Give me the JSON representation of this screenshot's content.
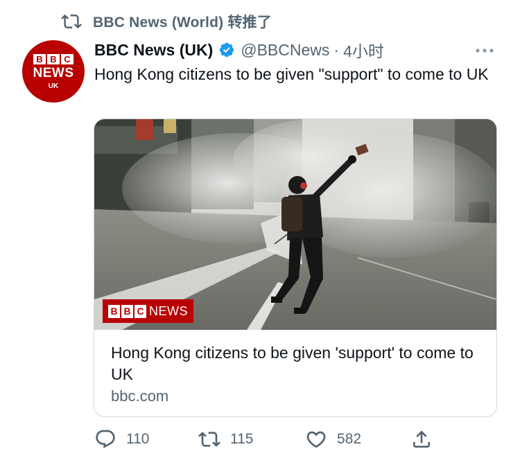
{
  "retweet": {
    "by": "BBC News (World) 转推了",
    "icon": "retweet-icon"
  },
  "author": {
    "avatar": {
      "bbc_letters": [
        "B",
        "B",
        "C"
      ],
      "news": "NEWS",
      "region": "UK",
      "color": "#b80000"
    },
    "display_name": "BBC News (UK)",
    "verified": true,
    "handle": "@BBCNews",
    "separator": "·",
    "time": "4小时"
  },
  "tweet": {
    "text": "Hong Kong citizens to be given \"support\" to come to UK"
  },
  "card": {
    "badge": {
      "bbc_letters": [
        "B",
        "B",
        "C"
      ],
      "news": "NEWS"
    },
    "title": "Hong Kong citizens to be given 'support' to come to UK",
    "domain": "bbc.com"
  },
  "actions": {
    "replies": "110",
    "retweets": "115",
    "likes": "582"
  },
  "colors": {
    "accent": "#1d9bf0",
    "secondary_text": "#536471",
    "bbc_red": "#b80000"
  }
}
